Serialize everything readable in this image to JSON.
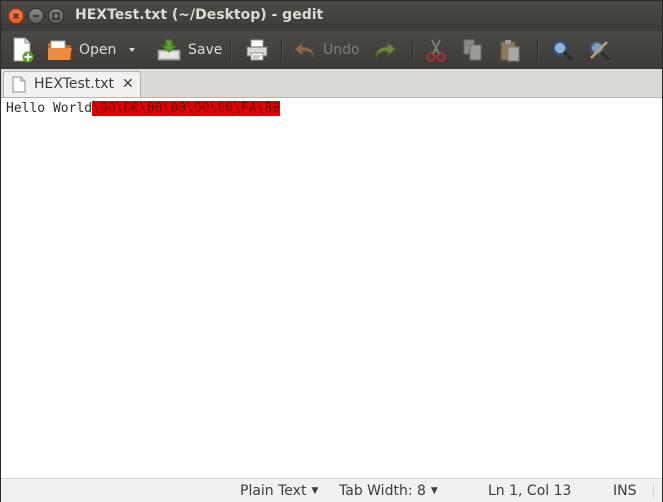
{
  "window": {
    "title": "HEXTest.txt (~/Desktop) - gedit"
  },
  "toolbar": {
    "open_label": "Open",
    "save_label": "Save",
    "undo_label": "Undo"
  },
  "tab": {
    "label": "HEXTest.txt",
    "close": "✕"
  },
  "editor": {
    "plain_text": "Hello World",
    "hex_text": "\\00\\00\\00\\00\\00\\00\\FA\\B0",
    "highlight_color": "#e40000"
  },
  "statusbar": {
    "language": "Plain Text",
    "tab_width": "Tab Width: 8",
    "position": "Ln 1, Col 13",
    "mode": "INS"
  },
  "colors": {
    "titlebar": "#3c3b37",
    "close_button": "#df4a16"
  }
}
